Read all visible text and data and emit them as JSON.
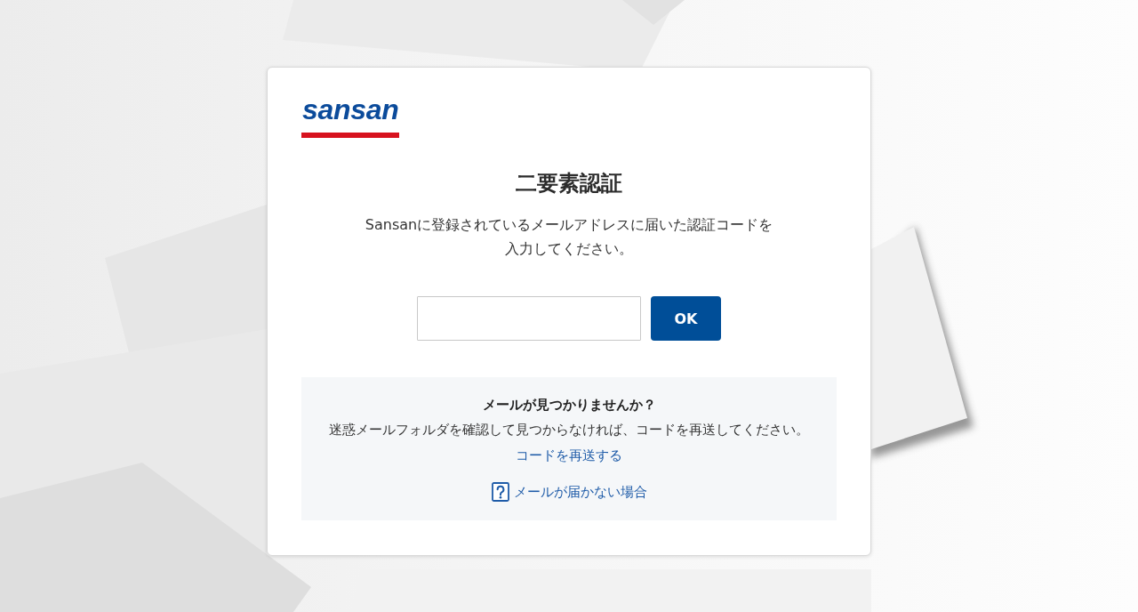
{
  "logo": {
    "text": "sansan"
  },
  "title": "二要素認証",
  "description": "Sansanに登録されているメールアドレスに届いた認証コードを入力してください。",
  "code_form": {
    "submit_button": "OK"
  },
  "help": {
    "heading": "メールが見つかりませんか？",
    "text": "迷惑メールフォルダを確認して見つからなければ、コードを再送してください。",
    "resend_link": "コードを再送する",
    "help_link": "メールが届かない場合"
  }
}
